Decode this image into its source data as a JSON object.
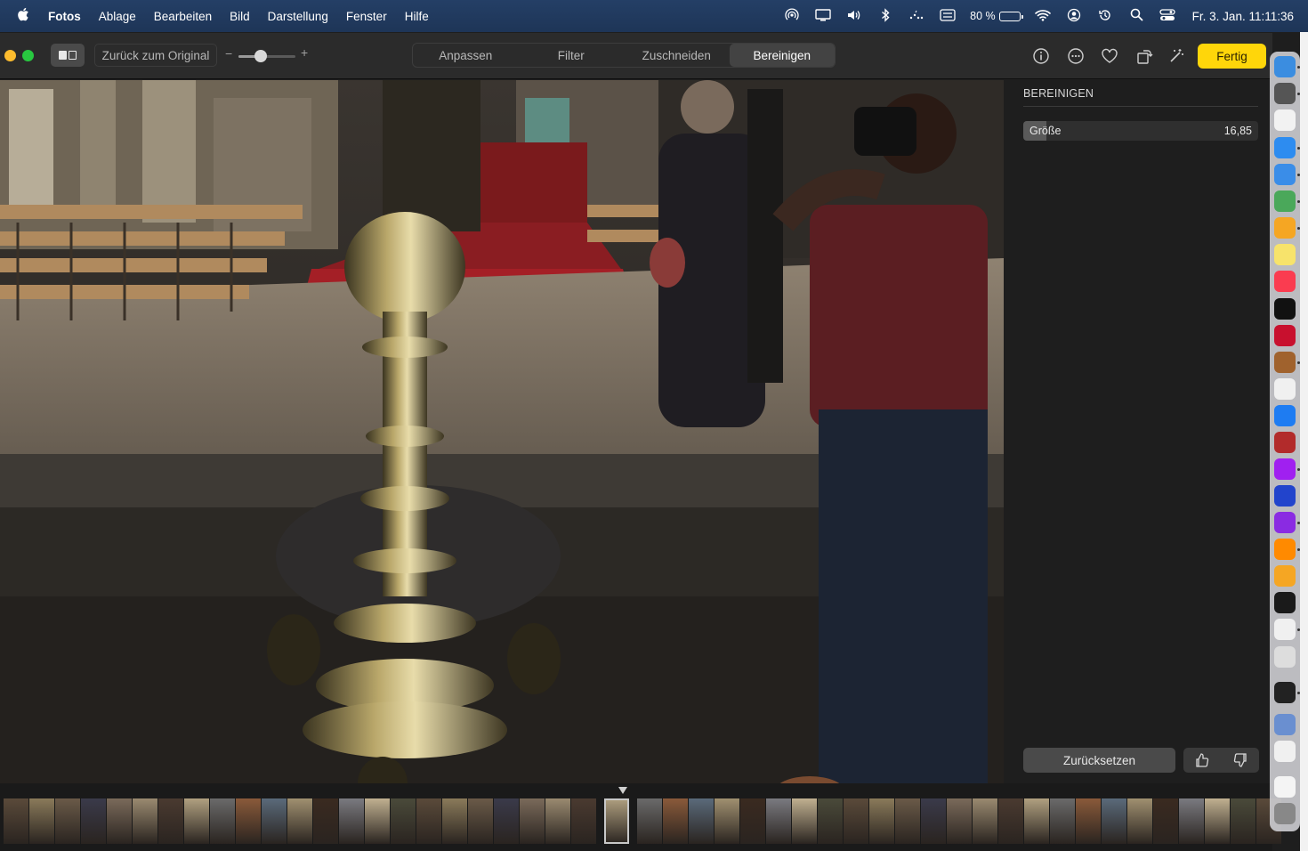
{
  "menubar": {
    "apple_icon": "apple-logo",
    "app_name": "Fotos",
    "menus": [
      "Ablage",
      "Bearbeiten",
      "Bild",
      "Darstellung",
      "Fenster",
      "Hilfe"
    ],
    "status_icons": [
      "airdrop-icon",
      "display-icon",
      "volume-icon",
      "bluetooth-icon",
      "control-icon",
      "keyboard-icon"
    ],
    "battery_percent": "80 %",
    "battery_level": 0.8,
    "tray_icons": [
      "wifi-icon",
      "user-icon",
      "time-machine-icon",
      "spotlight-icon",
      "control-center-icon"
    ],
    "clock": "Fr. 3. Jan.  11:11:36"
  },
  "toolbar": {
    "revert_label": "Zurück zum Original",
    "zoom_minus": "−",
    "zoom_plus": "+",
    "zoom_level": 0.35,
    "tabs": [
      {
        "label": "Anpassen",
        "active": false
      },
      {
        "label": "Filter",
        "active": false
      },
      {
        "label": "Zuschneiden",
        "active": false
      },
      {
        "label": "Bereinigen",
        "active": true
      }
    ],
    "done_label": "Fertig",
    "accent_color": "#ffd60a"
  },
  "panel": {
    "title": "BEREINIGEN",
    "size_label": "Größe",
    "size_value": "16,85",
    "size_fraction": 0.1,
    "reset_label": "Zurücksetzen"
  },
  "filmstrip": {
    "thumbnail_count": 49
  },
  "dock": {
    "apps": [
      "finder",
      "launchpad",
      "calendar",
      "safari",
      "mail",
      "maps",
      "photos",
      "notes",
      "music",
      "apple-tv",
      "affinity",
      "bear",
      "reminders",
      "app-store",
      "dictionary",
      "feedback",
      "vpn",
      "podcasts",
      "books",
      "pages",
      "perplexity",
      "script-editor",
      "disk-utility",
      "terminal",
      "preview",
      "archive-utility",
      "document",
      "trash"
    ]
  }
}
